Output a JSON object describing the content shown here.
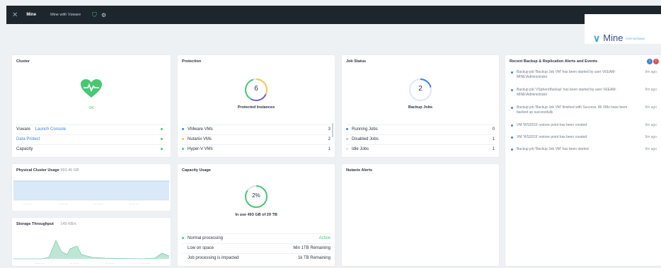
{
  "topbar": {
    "brand": "Mine",
    "cluster": "Mine with Vsware",
    "status_symbol": "⚙"
  },
  "logo": {
    "name": "Mine",
    "tag": "FOR NUTANIX"
  },
  "cluster": {
    "title": "Cluster",
    "health": "OK",
    "rows": [
      {
        "label": "Vsware",
        "link": "Launch Console"
      },
      {
        "label": "Data Protect"
      },
      {
        "label": "Capacity"
      }
    ]
  },
  "protection": {
    "title": "Protection",
    "count": "6",
    "count_label": "Protected Instances",
    "rows": [
      {
        "label": "VMware VMs",
        "value": "3"
      },
      {
        "label": "Nutanix VMs",
        "value": "2"
      },
      {
        "label": "Hyper-V VMs",
        "value": "1"
      }
    ]
  },
  "job_status": {
    "title": "Job Status",
    "count": "2",
    "count_label": "Backup Jobs",
    "rows": [
      {
        "label": "Running Jobs",
        "value": "0"
      },
      {
        "label": "Disabled Jobs",
        "value": "1"
      },
      {
        "label": "Idle Jobs",
        "value": "1"
      }
    ]
  },
  "alerts_panel": {
    "title": "Recent Backup & Replication Alerts and Events",
    "items": [
      {
        "text": "Backup job 'Backup Job VM' has been started by user VEEAM-MINE\\Administrator",
        "age": "9m ago"
      },
      {
        "text": "Backup job 'VSphereBackup' has been started by user VEEAM-MINE\\Administrator",
        "age": "9m ago"
      },
      {
        "text": "Backup job 'Backup Job VM' finished with Success. All VMs have been backed up successfully",
        "age": "9m ago"
      },
      {
        "text": "VM 'WS2019' restore point has been created",
        "age": "9m ago"
      },
      {
        "text": "VM 'WS2019' restore point has been created",
        "age": "9m ago"
      },
      {
        "text": "Backup job 'Backup Job VM' has been started",
        "age": "9m ago"
      }
    ]
  },
  "physical_usage": {
    "title": "Physical Cluster Usage",
    "subtitle": "993.46 GB"
  },
  "storage": {
    "title": "Storage Throughput",
    "subtitle": "149 KB/s"
  },
  "capacity": {
    "title": "Capacity Usage",
    "percent": "2%",
    "summary": "In use 493 GB of 29 TB",
    "rows": [
      {
        "label": "Normal processing",
        "value": "Active"
      },
      {
        "label": "Low on space",
        "value": "Min 1TB Remaining"
      },
      {
        "label": "Job processing is impacted",
        "value": "1k TB Remaining"
      }
    ]
  },
  "nutanix_alerts": {
    "title": "Nutanix Alerts"
  },
  "colors": {
    "accent": "#3a86d8",
    "ok": "#48c774",
    "bg": "#eef1f4",
    "topbar": "#1d252d"
  }
}
